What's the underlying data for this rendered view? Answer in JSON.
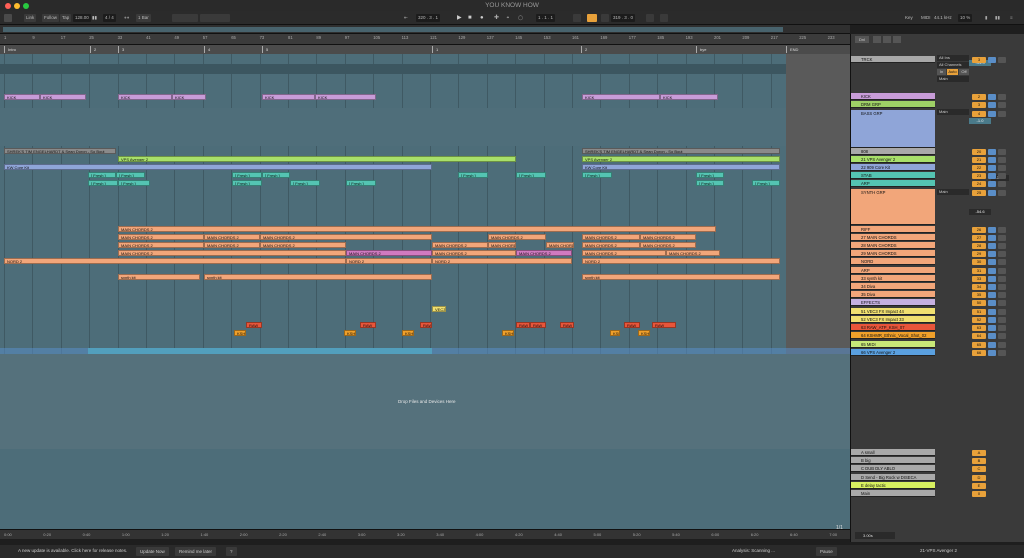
{
  "window": {
    "title": "YOU KNOW HOW"
  },
  "control_bar": {
    "link": "Link",
    "follow": "Follow",
    "tap": "Tap",
    "tempo": "128.00",
    "signature": "4 / 4",
    "quantize": "1 Bar",
    "position": "320 .  3 .  1",
    "loop_start": "1 .  1 .  1",
    "loop_length": "319 .  3 .  0",
    "key": "Key",
    "midi": "MIDI",
    "sample_rate": "44.1 kHz",
    "cpu": "10 %"
  },
  "ruler_bars": [
    "1",
    "9",
    "17",
    "25",
    "33",
    "41",
    "49",
    "57",
    "65",
    "73",
    "81",
    "89",
    "97",
    "105",
    "113",
    "121",
    "129",
    "137",
    "145",
    "153",
    "161",
    "169",
    "177",
    "185",
    "193",
    "201",
    "209",
    "217",
    "225",
    "233"
  ],
  "locators": [
    {
      "label": "Intro"
    },
    {
      "label": "2"
    },
    {
      "label": "3"
    },
    {
      "label": "4"
    },
    {
      "label": "5"
    },
    {
      "label": "1"
    },
    {
      "label": "2"
    },
    {
      "label": "bye"
    },
    {
      "label": "END"
    }
  ],
  "clips": {
    "kick": "KICK",
    "vocal": "SHREK'S TIM ENGELHARDT & Sean Doron - So Bout",
    "vps": "VPS Avenger 2",
    "core": "KW Core Kit",
    "fresh": "[ Fresh ]",
    "main_chords": "MAIN CHORDS 2",
    "nord": "NORD 2",
    "synth": "synth kit",
    "vec": "VEC3 FX",
    "raw": "RAW",
    "ksh": "KSH"
  },
  "drop_text": "Drop Files and Devices Here",
  "page_indicator": "1/1",
  "time_markers": [
    "0:00",
    "0:20",
    "0:40",
    "1:00",
    "1:20",
    "1:40",
    "2:00",
    "2:20",
    "2:40",
    "3:00",
    "3:20",
    "3:40",
    "4:00",
    "4:20",
    "4:40",
    "5:00",
    "5:20",
    "5:40",
    "6:00",
    "6:20",
    "6:40",
    "7:00"
  ],
  "mixer": {
    "header_tab": "Dnl",
    "io_all_ins": "All Ins",
    "io_all_channels": "All Channels",
    "io_in": "In",
    "io_auto": "Auto",
    "io_off": "Off",
    "io_main": "Main",
    "vol_a": "-34.3",
    "vol_b": "-54.6",
    "vol_c": "-39.0",
    "vol_d": "-1.0",
    "tracks": [
      {
        "name": "TRCK",
        "num": "3",
        "color": "#a8a8a8"
      },
      {
        "name": "KICK",
        "num": "2",
        "color": "#c89cd8"
      },
      {
        "name": "DRM GRP",
        "num": "3",
        "color": "#9ed066"
      },
      {
        "name": "BASS GRP",
        "num": "4",
        "color": "#8fa5d8"
      },
      {
        "name": "808",
        "num": "20",
        "color": "#a9a9a9"
      },
      {
        "name": "21 VPS Avenger 2",
        "num": "21",
        "color": "#a8e06a"
      },
      {
        "name": "22 909 Core Kit",
        "num": "22",
        "color": "#8fa5d8"
      },
      {
        "name": "STAB",
        "num": "23",
        "color": "#54c4b2"
      },
      {
        "name": "ARP",
        "num": "24",
        "color": "#54c4b2"
      },
      {
        "name": "SYNTH GRP",
        "num": "25",
        "color": "#f2a67a"
      },
      {
        "name": "RIFF",
        "num": "26",
        "color": "#f2a67a"
      },
      {
        "name": "27 MAIN CHORDS",
        "num": "27",
        "color": "#f2a67a"
      },
      {
        "name": "28 MAIN CHORDS",
        "num": "28",
        "color": "#f2a67a"
      },
      {
        "name": "29 MAIN CHORDS",
        "num": "29",
        "color": "#f2a67a"
      },
      {
        "name": "NORD",
        "num": "30",
        "color": "#f2a67a"
      },
      {
        "name": "ARP",
        "num": "31",
        "color": "#f2a67a"
      },
      {
        "name": "33 synth kit",
        "num": "33",
        "color": "#f2a67a"
      },
      {
        "name": "34 Diva",
        "num": "34",
        "color": "#f2a67a"
      },
      {
        "name": "35 Diva",
        "num": "35",
        "color": "#f2a67a"
      },
      {
        "name": "EFFECTS",
        "num": "50",
        "color": "#c5b0e0"
      },
      {
        "name": "51 VEC3 FX Impact 44",
        "num": "51",
        "color": "#f0e070"
      },
      {
        "name": "52 VEC3 FX Impact 33",
        "num": "52",
        "color": "#f0e070"
      },
      {
        "name": "63 RAW_ATP_KSH_07",
        "num": "63",
        "color": "#e8553a"
      },
      {
        "name": "64 KSHMR_Ethnic_Vocal_Shot_02",
        "num": "64",
        "color": "#f0a02a"
      },
      {
        "name": "65 MIDI",
        "num": "65",
        "color": "#c8e878"
      },
      {
        "name": "66 VPS Avenger 2",
        "num": "66",
        "color": "#5aa0e0"
      }
    ],
    "returns": [
      {
        "name": "A small",
        "num": "A",
        "color": "#a9a9a9"
      },
      {
        "name": "B big",
        "num": "B",
        "color": "#a9a9a9"
      },
      {
        "name": "C DUB DLY ABLO",
        "num": "C",
        "color": "#a9a9a9"
      },
      {
        "name": "D Send - Big Rock w DISECA",
        "num": "D",
        "color": "#a9a9a9"
      },
      {
        "name": "E delay tactic",
        "num": "E",
        "color": "#d8f060"
      },
      {
        "name": "Main",
        "num": "0",
        "color": "#a9a9a9"
      }
    ],
    "bottom_vol": "3.00s",
    "current_track": "21-VPS Avenger 2"
  },
  "status": {
    "message": "A new update is available. Click here for release notes.",
    "update_now": "Update Now",
    "remind_later": "Remind me later",
    "help": "?",
    "analysis": "Analysis: Scanning ...",
    "pause": "Pause"
  }
}
